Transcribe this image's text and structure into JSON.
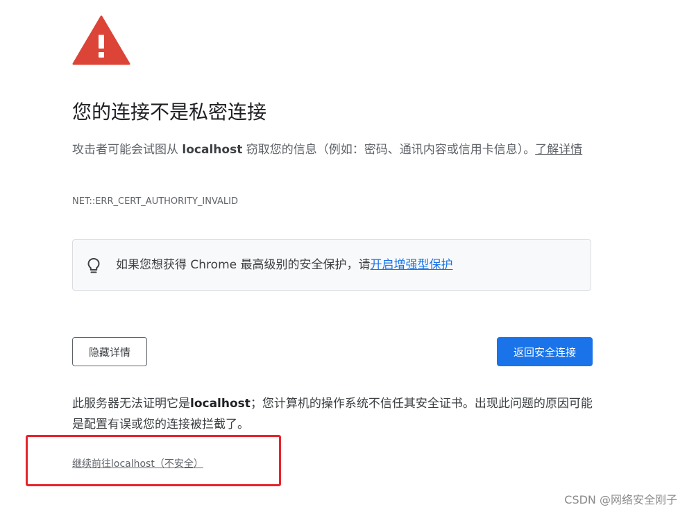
{
  "colors": {
    "warning_icon": "#db4437",
    "link": "#1a73e8",
    "primary_button": "#1a73e8",
    "highlight_box": "#e8242b",
    "tip_background": "#f8f9fa"
  },
  "icons": {
    "warning": "warning-triangle-icon",
    "tip": "lightbulb-icon"
  },
  "heading": {
    "title": "您的连接不是私密连接"
  },
  "description": {
    "prefix": "攻击者可能会试图从 ",
    "host": "localhost",
    "suffix": " 窃取您的信息（例如：密码、通讯内容或信用卡信息）。",
    "learn_more": "了解详情"
  },
  "error_code": "NET::ERR_CERT_AUTHORITY_INVALID",
  "enhanced_protection": {
    "text": "如果您想获得 Chrome 最高级别的安全保护，请",
    "link": "开启增强型保护"
  },
  "buttons": {
    "hide_details": "隐藏详情",
    "back_to_safety": "返回安全连接"
  },
  "details": {
    "prefix": "此服务器无法证明它是",
    "host": "localhost",
    "suffix": "；您计算机的操作系统不信任其安全证书。出现此问题的原因可能是配置有误或您的连接被拦截了。"
  },
  "proceed_link": "继续前往localhost（不安全）",
  "watermark": "CSDN @网络安全刚子"
}
